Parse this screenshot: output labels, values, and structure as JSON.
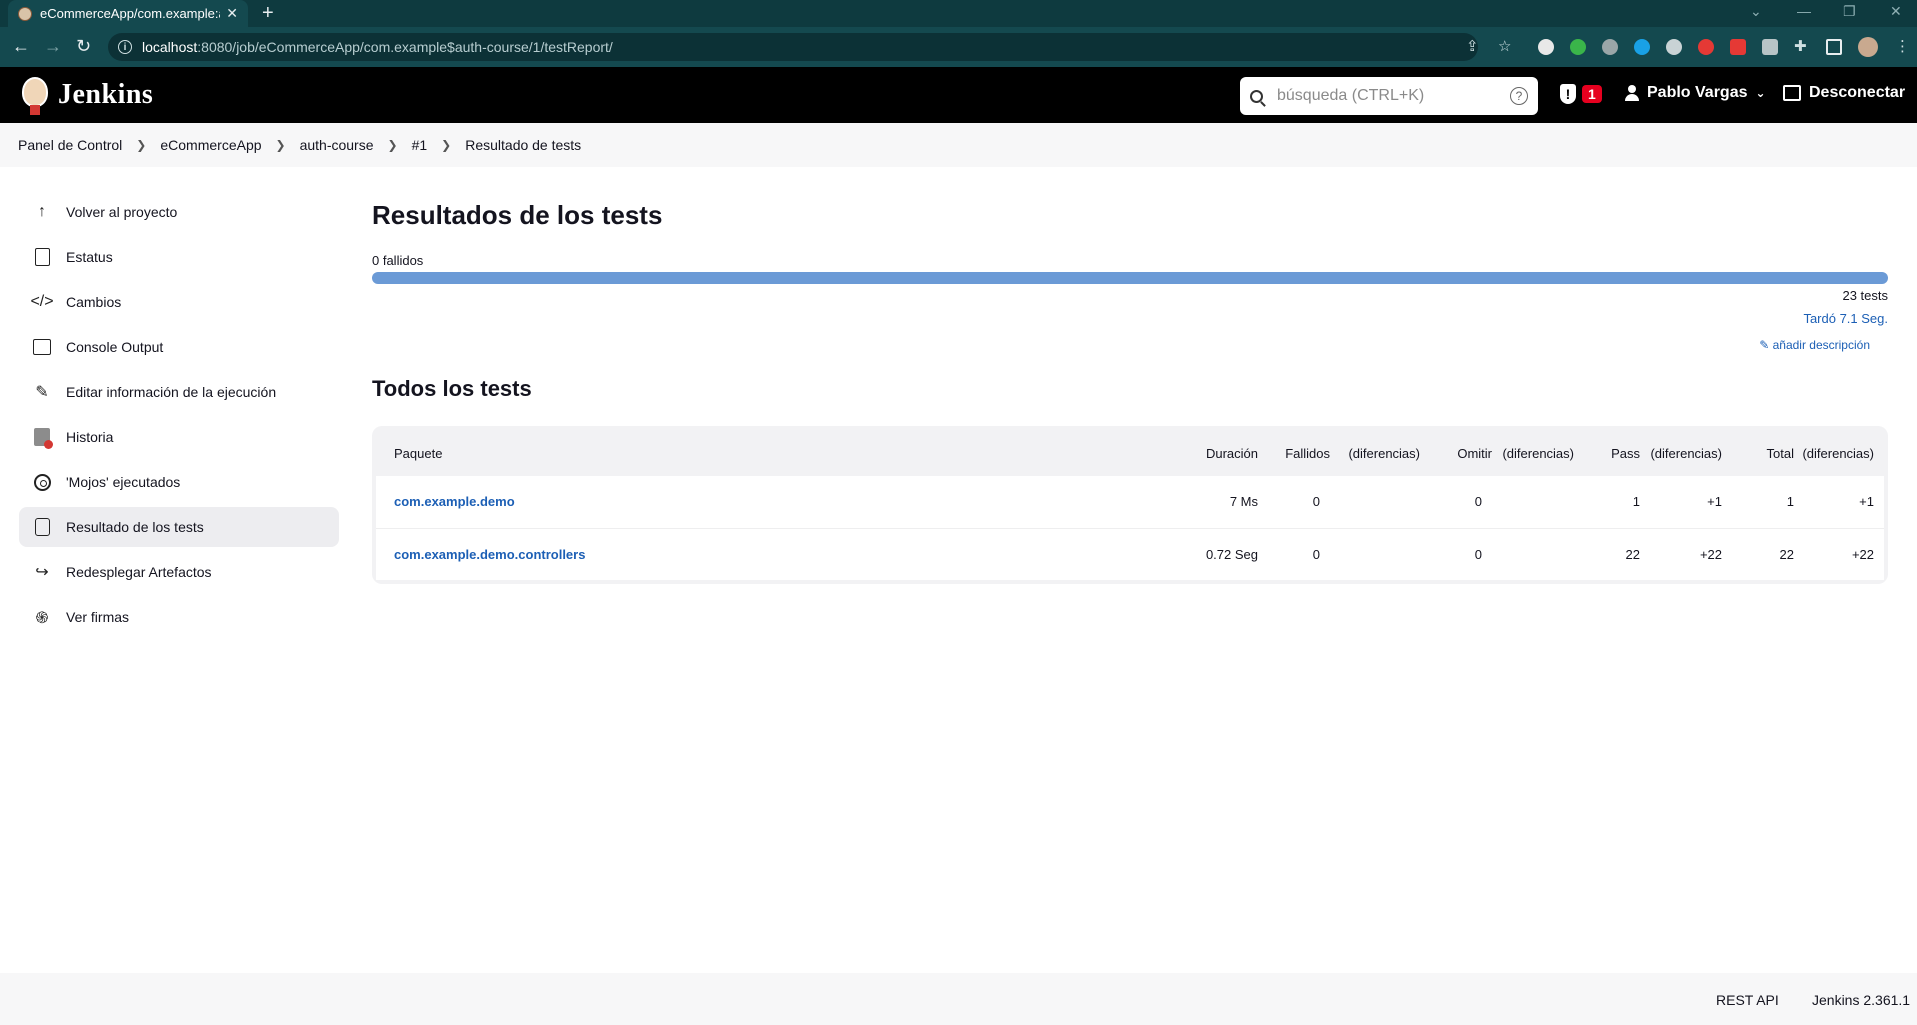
{
  "browser": {
    "tab_title": "eCommerceApp/com.example:auth-course",
    "url_host": "localhost",
    "url_path": ":8080/job/eCommerceApp/com.example$auth-course/1/testReport/"
  },
  "header": {
    "app_name": "Jenkins",
    "search_placeholder": "búsqueda (CTRL+K)",
    "search_help": "?",
    "alert_count": "1",
    "user_name": "Pablo Vargas",
    "logout_label": "Desconectar"
  },
  "breadcrumb": [
    "Panel de Control",
    "eCommerceApp",
    "auth-course",
    "#1",
    "Resultado de tests"
  ],
  "sidebar": {
    "items": [
      {
        "label": "Volver al proyecto",
        "icon": "arrow-up-icon"
      },
      {
        "label": "Estatus",
        "icon": "document-icon"
      },
      {
        "label": "Cambios",
        "icon": "code-icon"
      },
      {
        "label": "Console Output",
        "icon": "terminal-icon"
      },
      {
        "label": "Editar información de la ejecución",
        "icon": "edit-icon"
      },
      {
        "label": "Historia",
        "icon": "history-icon"
      },
      {
        "label": "'Mojos' ejecutados",
        "icon": "gear-icon"
      },
      {
        "label": "Resultado de los tests",
        "icon": "clipboard-icon"
      },
      {
        "label": "Redesplegar Artefactos",
        "icon": "share-icon"
      },
      {
        "label": "Ver firmas",
        "icon": "fingerprint-icon"
      }
    ]
  },
  "main": {
    "title": "Resultados de los tests",
    "failed_label": "0 fallidos",
    "pass_fraction": 1.0,
    "tests_total_label": "23 tests",
    "duration_label": "Tardó 7.1 Seg.",
    "add_description": "añadir descripción",
    "all_tests_title": "Todos los tests",
    "table": {
      "headers": {
        "package": "Paquete",
        "duration": "Duración",
        "failed": "Fallidos",
        "failed_diff": "(diferencias)",
        "skipped": "Omitir",
        "skipped_diff": "(diferencias)",
        "pass": "Pass",
        "pass_diff": "(diferencias)",
        "total": "Total",
        "total_diff": "(diferencias)"
      },
      "rows": [
        {
          "package": "com.example.demo",
          "duration": "7 Ms",
          "failed": "0",
          "failed_diff": "",
          "skipped": "0",
          "skipped_diff": "",
          "pass": "1",
          "pass_diff": "+1",
          "total": "1",
          "total_diff": "+1"
        },
        {
          "package": "com.example.demo.controllers",
          "duration": "0.72 Seg",
          "failed": "0",
          "failed_diff": "",
          "skipped": "0",
          "skipped_diff": "",
          "pass": "22",
          "pass_diff": "+22",
          "total": "22",
          "total_diff": "+22"
        }
      ]
    }
  },
  "footer": {
    "rest_api": "REST API",
    "version": "Jenkins 2.361.1"
  },
  "colors": {
    "header_bg": "#000000",
    "progress_bar": "#6b9ad6",
    "link": "#1c5fb5",
    "alert_badge": "#e6001f"
  }
}
